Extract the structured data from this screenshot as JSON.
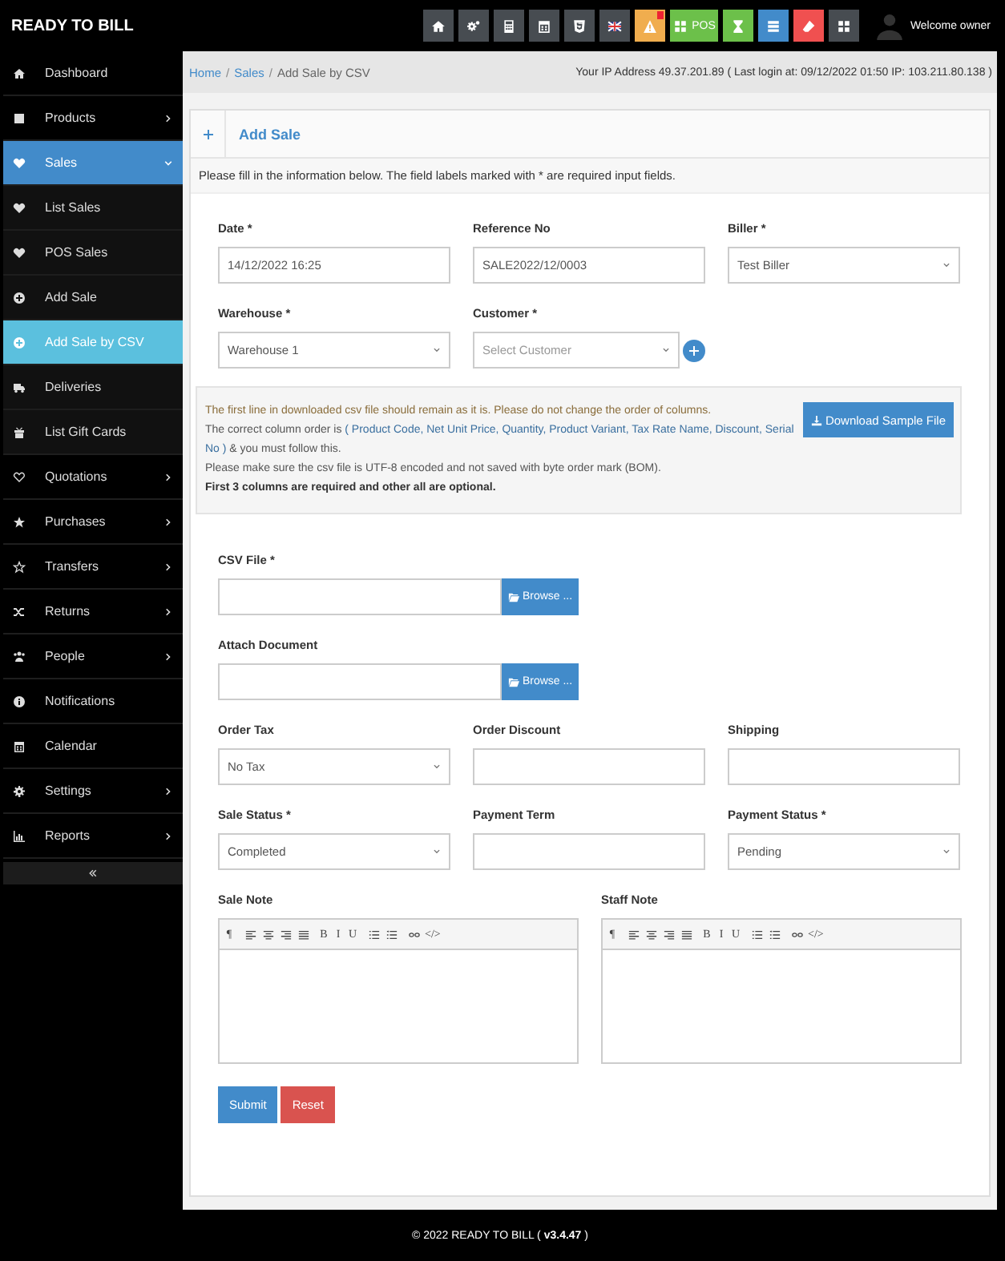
{
  "brand": "READY TO BILL",
  "toolbar": [
    {
      "kind": "home",
      "color": "#474c51",
      "alert": false
    },
    {
      "kind": "cogs",
      "color": "#474c51",
      "alert": false
    },
    {
      "kind": "calculator",
      "color": "#474c51",
      "alert": false
    },
    {
      "kind": "calendar",
      "color": "#474c51",
      "alert": false
    },
    {
      "kind": "shield",
      "color": "#474c51",
      "alert": false
    },
    {
      "kind": "flag",
      "color": "#474c51",
      "alert": false
    },
    {
      "kind": "warning",
      "color": "#f0ad4e",
      "alert": true
    },
    {
      "kind": "grid",
      "label": "POS",
      "color": "#6cc04a",
      "alert": false
    },
    {
      "kind": "hourglass",
      "color": "#6cc04a",
      "alert": false
    },
    {
      "kind": "list",
      "color": "#428bca",
      "alert": false
    },
    {
      "kind": "eraser",
      "color": "#f05050",
      "alert": false
    },
    {
      "kind": "grid",
      "color": "#474c51",
      "alert": false
    }
  ],
  "user": {
    "greeting": "Welcome owner"
  },
  "sidebar": {
    "items": [
      {
        "label": "Dashboard",
        "kind": "dashboard",
        "selected": false
      },
      {
        "label": "Products",
        "kind": "products",
        "expanded": false,
        "selected": false
      },
      {
        "label": "Sales",
        "kind": "heart",
        "expanded": true,
        "selected": true,
        "children": [
          {
            "label": "List Sales",
            "kind": "heart",
            "selected": false
          },
          {
            "label": "POS Sales",
            "kind": "heart",
            "selected": false
          },
          {
            "label": "Add Sale",
            "kind": "plus-circle",
            "selected": false
          },
          {
            "label": "Add Sale by CSV",
            "kind": "plus-circle",
            "selected": true
          },
          {
            "label": "Deliveries",
            "kind": "truck",
            "selected": false
          },
          {
            "label": "List Gift Cards",
            "kind": "gift",
            "selected": false
          }
        ]
      },
      {
        "label": "Quotations",
        "kind": "heart-o",
        "expanded": false,
        "selected": false
      },
      {
        "label": "Purchases",
        "kind": "star",
        "expanded": false,
        "selected": false
      },
      {
        "label": "Transfers",
        "kind": "star-o",
        "expanded": false,
        "selected": false
      },
      {
        "label": "Returns",
        "kind": "shuffle",
        "expanded": false,
        "selected": false
      },
      {
        "label": "People",
        "kind": "users",
        "expanded": false,
        "selected": false
      },
      {
        "label": "Notifications",
        "kind": "info",
        "selected": false
      },
      {
        "label": "Calendar",
        "kind": "calendar",
        "selected": false
      },
      {
        "label": "Settings",
        "kind": "gear",
        "expanded": false,
        "selected": false
      },
      {
        "label": "Reports",
        "kind": "bar-chart",
        "expanded": false,
        "selected": false
      }
    ]
  },
  "breadcrumb": {
    "separator": "/",
    "items": [
      {
        "label": "Home",
        "current": false
      },
      {
        "label": "Sales",
        "current": false
      },
      {
        "label": "Add Sale by CSV",
        "current": true
      }
    ]
  },
  "login_info": "Your IP Address 49.37.201.89 ( Last login at: 09/12/2022 01:50 IP: 103.211.80.138 )",
  "panel": {
    "title": "Add Sale",
    "intro": "Please fill in the information below. The field labels marked with * are required input fields."
  },
  "form": {
    "sections": [
      {
        "kind": "grid",
        "fields": [
          {
            "kind": "text",
            "label": "Date *",
            "value": "14/12/2022 16:25"
          },
          {
            "kind": "text",
            "label": "Reference No",
            "value": "SALE2022/12/0003"
          },
          {
            "kind": "select",
            "label": "Biller *",
            "value": "Test Biller"
          }
        ]
      },
      {
        "kind": "grid",
        "fields": [
          {
            "kind": "select",
            "label": "Warehouse *",
            "value": "Warehouse 1"
          },
          {
            "kind": "select",
            "label": "Customer *",
            "placeholder": "Select Customer",
            "add_button": true
          }
        ]
      },
      {
        "kind": "notice",
        "lines": [
          {
            "kind": "warning",
            "text": "The first line in downloaded csv file should remain as it is. Please do not change the order of columns."
          },
          {
            "kind": "columns",
            "text": "The correct column order is ",
            "highlight": "( Product Code, Net Unit Price, Quantity, Product Variant, Tax Rate Name, Discount, Serial No )",
            "after": " & you must follow this."
          },
          {
            "kind": "plain",
            "text": "Please make sure the csv file is UTF-8 encoded and not saved with byte order mark (BOM)."
          },
          {
            "kind": "strong",
            "text": "First 3 columns are required and other all are optional."
          }
        ],
        "button": "Download Sample File"
      },
      {
        "kind": "single",
        "fields": [
          {
            "kind": "file",
            "label": "CSV File *",
            "button": "Browse ..."
          }
        ]
      },
      {
        "kind": "single",
        "fields": [
          {
            "kind": "file",
            "label": "Attach Document",
            "button": "Browse ..."
          }
        ]
      },
      {
        "kind": "grid",
        "fields": [
          {
            "kind": "select",
            "label": "Order Tax",
            "value": "No Tax"
          },
          {
            "kind": "text",
            "label": "Order Discount"
          },
          {
            "kind": "text",
            "label": "Shipping"
          }
        ]
      },
      {
        "kind": "grid",
        "fields": [
          {
            "kind": "select",
            "label": "Sale Status *",
            "value": "Completed"
          },
          {
            "kind": "text",
            "label": "Payment Term"
          },
          {
            "kind": "select",
            "label": "Payment Status *",
            "value": "Pending"
          }
        ]
      },
      {
        "kind": "pair",
        "fields": [
          {
            "kind": "editor",
            "label": "Sale Note",
            "tools": [
              [
                {
                  "kind": "glyph",
                  "text": "¶"
                }
              ],
              [
                {
                  "kind": "align-left"
                },
                {
                  "kind": "align-center"
                },
                {
                  "kind": "align-right"
                },
                {
                  "kind": "align-justify"
                }
              ],
              [
                {
                  "kind": "glyph",
                  "text": "B"
                },
                {
                  "kind": "glyph",
                  "text": "I"
                },
                {
                  "kind": "glyph",
                  "text": "U"
                }
              ],
              [
                {
                  "kind": "list-ul"
                },
                {
                  "kind": "list-ol"
                }
              ],
              [
                {
                  "kind": "link"
                },
                {
                  "kind": "glyph",
                  "text": "</>"
                }
              ]
            ]
          },
          {
            "kind": "editor",
            "label": "Staff Note",
            "tools": [
              [
                {
                  "kind": "glyph",
                  "text": "¶"
                }
              ],
              [
                {
                  "kind": "align-left"
                },
                {
                  "kind": "align-center"
                },
                {
                  "kind": "align-right"
                },
                {
                  "kind": "align-justify"
                }
              ],
              [
                {
                  "kind": "glyph",
                  "text": "B"
                },
                {
                  "kind": "glyph",
                  "text": "I"
                },
                {
                  "kind": "glyph",
                  "text": "U"
                }
              ],
              [
                {
                  "kind": "list-ul"
                },
                {
                  "kind": "list-ol"
                }
              ],
              [
                {
                  "kind": "link"
                },
                {
                  "kind": "glyph",
                  "text": "</>"
                }
              ]
            ]
          }
        ]
      }
    ],
    "buttons": [
      {
        "label": "Submit",
        "kind": "primary"
      },
      {
        "label": "Reset",
        "kind": "danger"
      }
    ]
  },
  "footer": "© 2022 READY TO BILL ( **v3.4.47** )"
}
